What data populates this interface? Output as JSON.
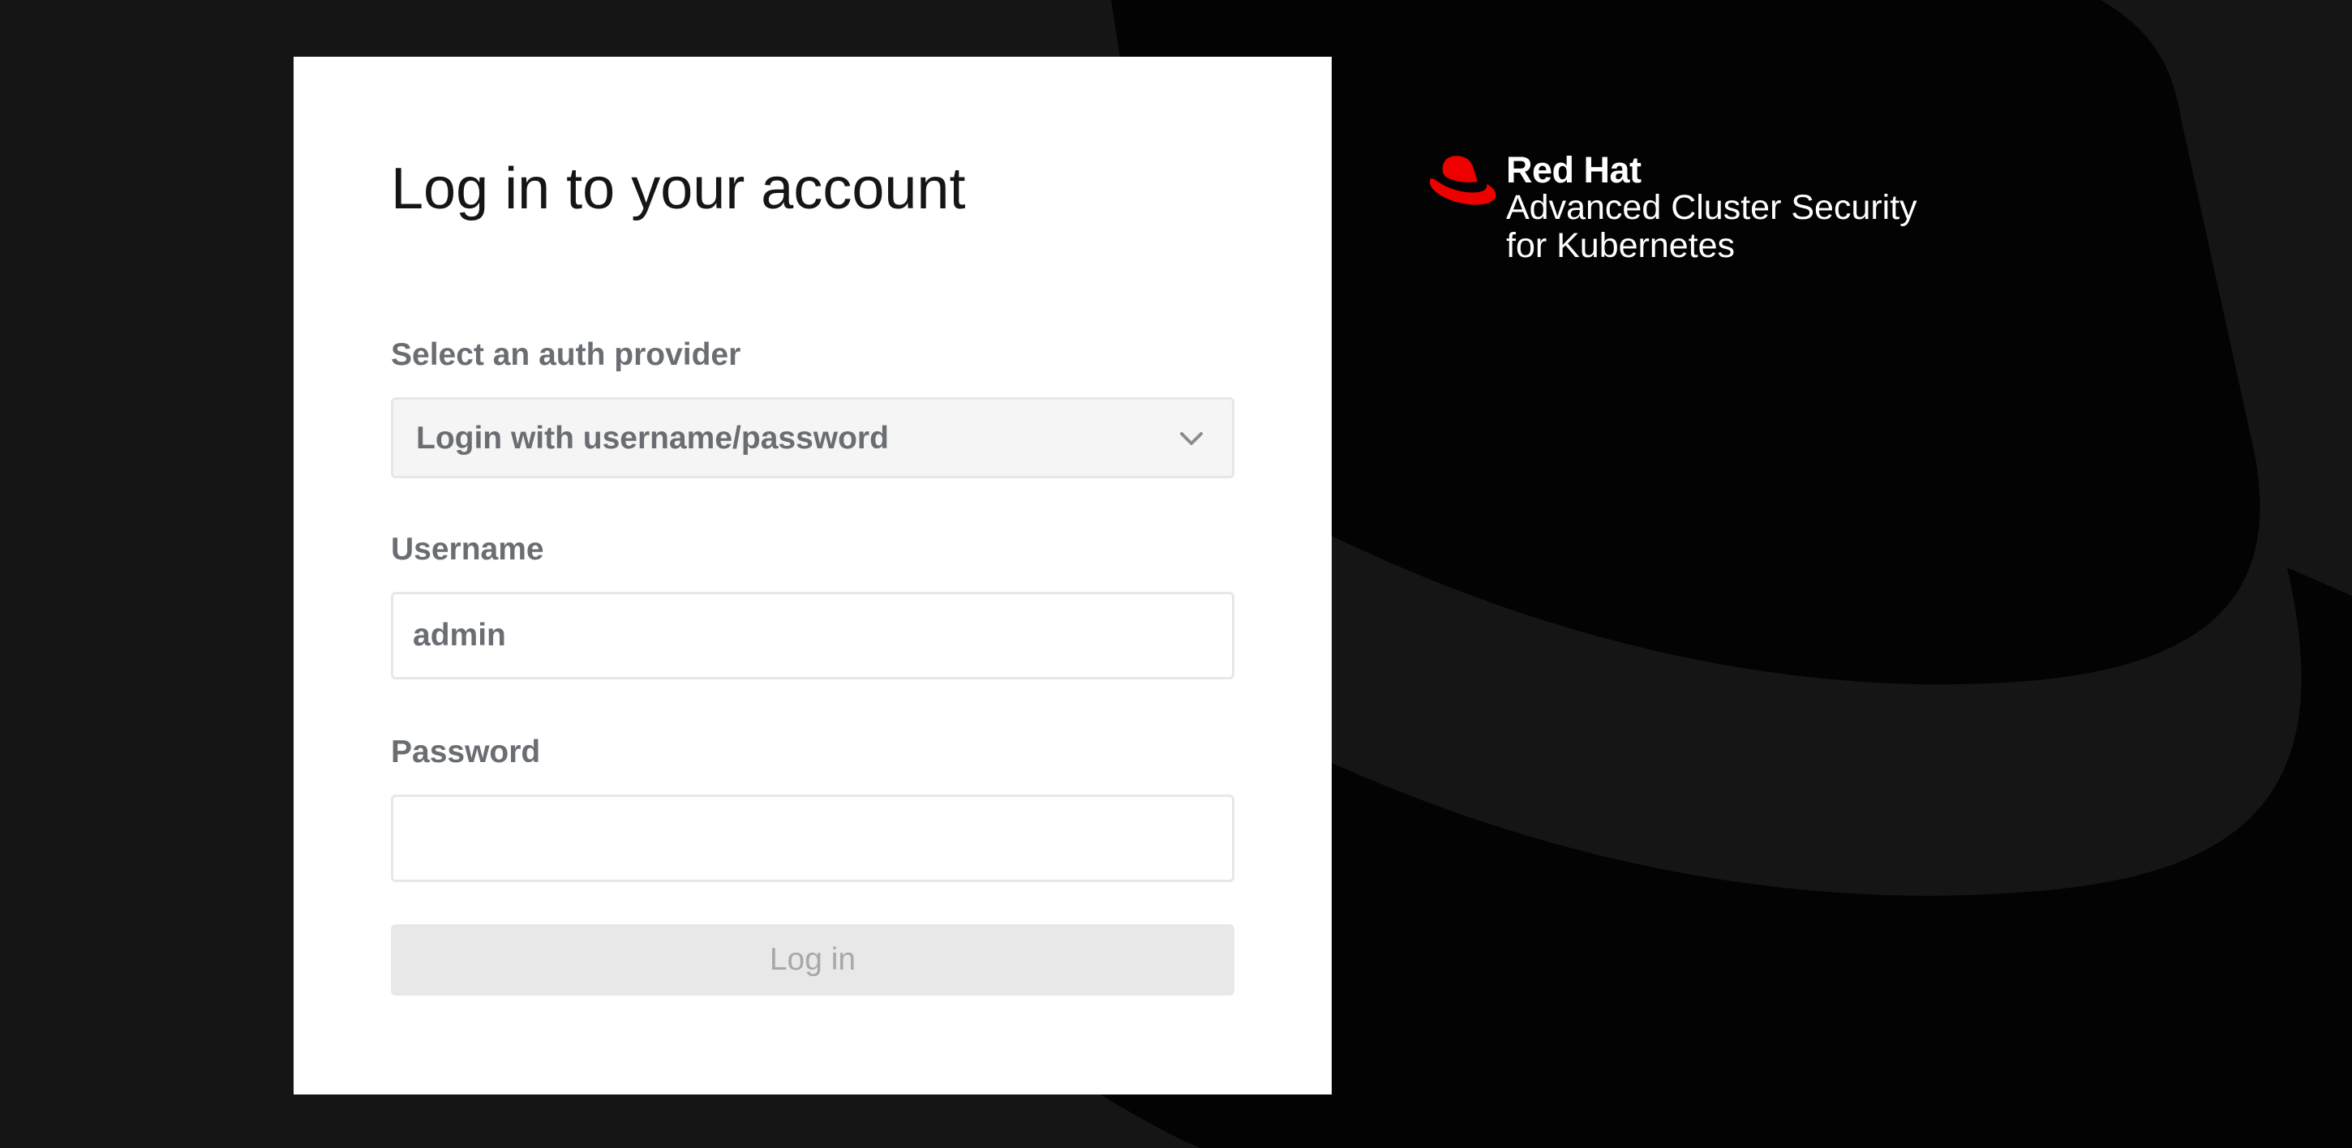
{
  "colors": {
    "page_background": "#151515",
    "hat_shape": "#030303",
    "card_background": "#ffffff",
    "brand_red": "#ee0000",
    "label_text": "#6a6e73",
    "disabled_button": "#e8e8e8"
  },
  "login": {
    "title": "Log in to your account",
    "auth_provider_label": "Select an auth provider",
    "auth_provider_selected": "Login with username/password",
    "auth_provider_icon": "chevron-down-icon",
    "username_label": "Username",
    "username_value": "admin",
    "password_label": "Password",
    "password_value": "",
    "submit_label": "Log in",
    "submit_disabled": true
  },
  "brand": {
    "logo_icon": "red-hat-fedora-icon",
    "name": "Red Hat",
    "product": "Advanced Cluster Security",
    "product_sub": "for Kubernetes"
  }
}
